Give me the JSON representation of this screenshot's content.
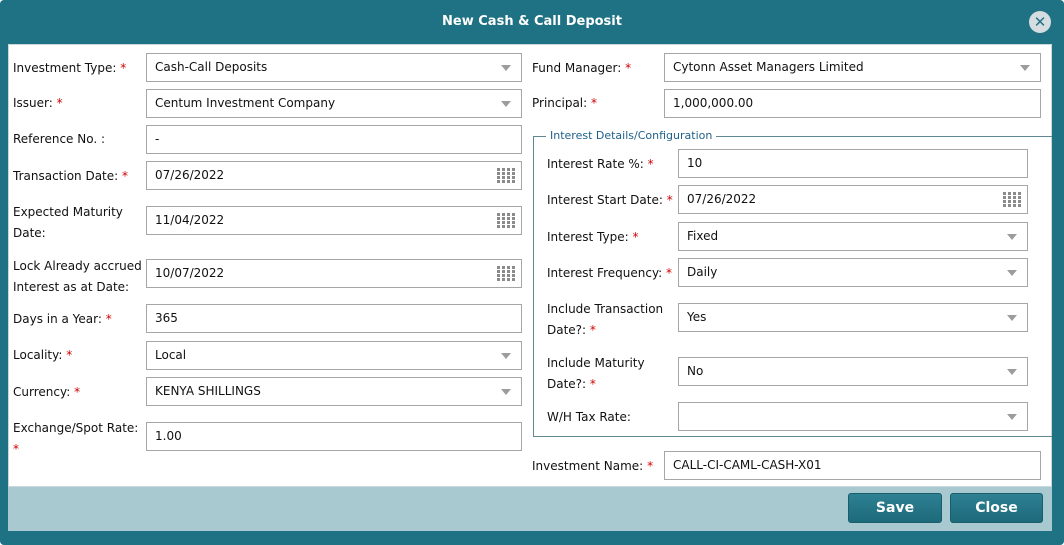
{
  "dialog": {
    "title": "New Cash & Call Deposit",
    "close_icon": "close-circle-icon"
  },
  "required_mark": "*",
  "left": {
    "investment_type": {
      "label": "Investment Type:",
      "value": "Cash-Call Deposits"
    },
    "issuer": {
      "label": "Issuer:",
      "value": "Centum Investment Company"
    },
    "reference_no": {
      "label": "Reference No. :",
      "value": "-"
    },
    "transaction_date": {
      "label": "Transaction Date:",
      "value": "07/26/2022"
    },
    "expected_maturity_date": {
      "label_line1": "Expected Maturity",
      "label_line2": "Date:",
      "value": "11/04/2022"
    },
    "lock_accrued": {
      "label_line1": "Lock Already accrued",
      "label_line2": "Interest as at Date:",
      "value": "10/07/2022"
    },
    "days_in_year": {
      "label": "Days in a Year:",
      "value": "365"
    },
    "locality": {
      "label": "Locality:",
      "value": "Local"
    },
    "currency": {
      "label": "Currency:",
      "value": "KENYA SHILLINGS"
    },
    "exchange_rate": {
      "label": "Exchange/Spot Rate:",
      "value": "1.00"
    }
  },
  "right": {
    "fund_manager": {
      "label": "Fund Manager:",
      "value": "Cytonn Asset Managers Limited"
    },
    "principal": {
      "label": "Principal:",
      "value": "1,000,000.00"
    },
    "interest_section": {
      "legend": "Interest Details/Configuration",
      "interest_rate": {
        "label": "Interest Rate %:",
        "value": "10"
      },
      "interest_start_date": {
        "label": "Interest Start Date:",
        "value": "07/26/2022"
      },
      "interest_type": {
        "label": "Interest Type:",
        "value": "Fixed"
      },
      "interest_frequency": {
        "label": "Interest Frequency:",
        "value": "Daily"
      },
      "include_transaction_date": {
        "label_line1": "Include Transaction",
        "label_line2": "Date?:",
        "value": "Yes"
      },
      "include_maturity_date": {
        "label_line1": "Include Maturity",
        "label_line2": "Date?:",
        "value": "No"
      },
      "wh_tax_rate": {
        "label": "W/H Tax Rate:",
        "value": ""
      }
    },
    "investment_name": {
      "label": "Investment Name:",
      "value": "CALL-CI-CAML-CASH-X01"
    }
  },
  "footer": {
    "save_label": "Save",
    "close_label": "Close"
  },
  "colors": {
    "titlebar": "#1f7283",
    "footer": "#a9c9d1",
    "required": "#d20000",
    "legend": "#1f5f8b"
  }
}
